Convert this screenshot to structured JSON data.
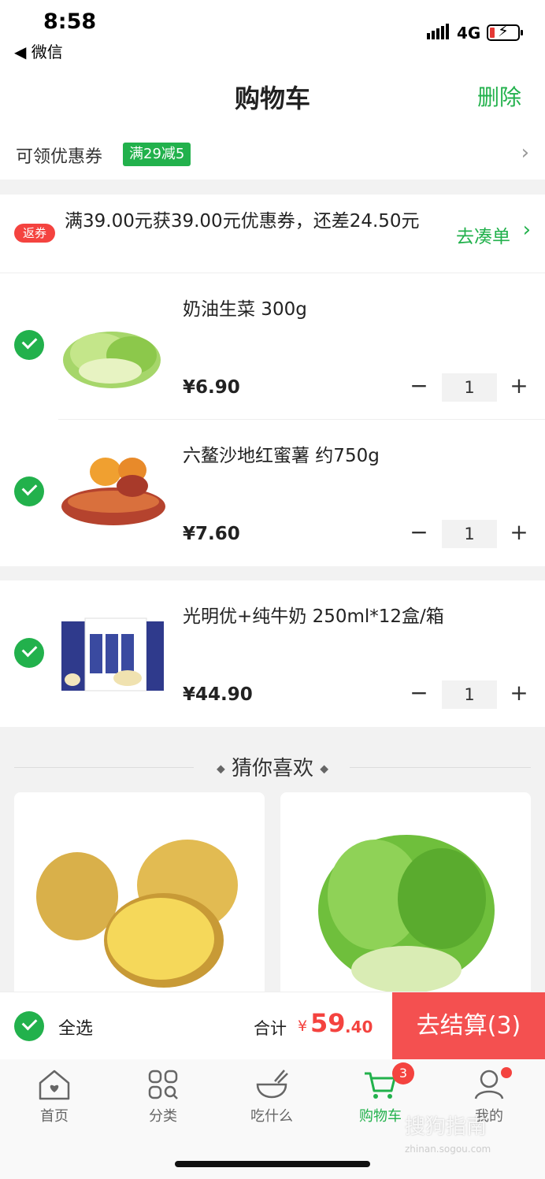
{
  "status": {
    "time": "8:58",
    "back_app": "◀ 微信",
    "network": "4G"
  },
  "nav": {
    "title": "购物车",
    "delete_label": "删除"
  },
  "coupon": {
    "label": "可领优惠券",
    "tag": "满29减5"
  },
  "promo": {
    "badge": "返券",
    "text": "满39.00元获39.00元优惠券，还差24.50元",
    "link": "去凑单"
  },
  "cart_items": [
    {
      "name": "奶油生菜 300g",
      "price": "¥6.90",
      "qty": "1"
    },
    {
      "name": "六鳌沙地红蜜薯 约750g",
      "price": "¥7.60",
      "qty": "1"
    },
    {
      "name": "光明优+纯牛奶 250ml*12盒/箱",
      "price": "¥44.90",
      "qty": "1"
    }
  ],
  "qty_controls": {
    "minus": "−",
    "plus": "+"
  },
  "recommend": {
    "title": "猜你喜欢"
  },
  "checkout": {
    "select_all": "全选",
    "total_label": "合计",
    "currency": "¥",
    "total_int": "59",
    "total_dec": ".40",
    "button": "去结算(3)"
  },
  "tabs": [
    {
      "label": "首页",
      "icon": "home-icon"
    },
    {
      "label": "分类",
      "icon": "category-icon"
    },
    {
      "label": "吃什么",
      "icon": "bowl-icon"
    },
    {
      "label": "购物车",
      "icon": "cart-icon",
      "badge": "3"
    },
    {
      "label": "我的",
      "icon": "profile-icon"
    }
  ],
  "watermark": {
    "text": "搜狗指南",
    "sub": "zhinan.sogou.com"
  },
  "colors": {
    "accent": "#22b14c",
    "price_red": "#f4433f",
    "checkout_red": "#f45050"
  }
}
